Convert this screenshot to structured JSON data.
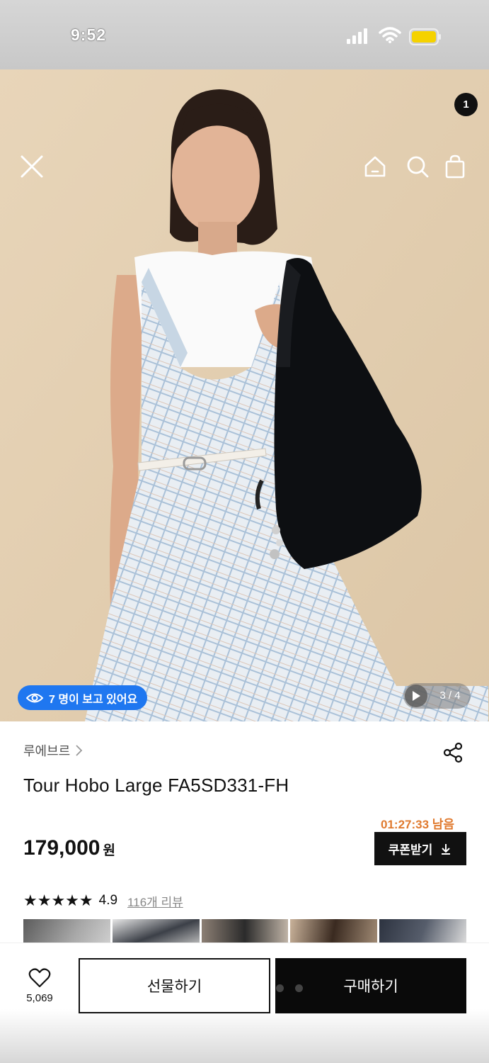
{
  "status": {
    "time": "9:52"
  },
  "hero": {
    "viewers": "7 명이 보고 있어요",
    "page": "3 / 4",
    "cart_count": "1"
  },
  "product": {
    "brand": "루에브르",
    "title": "Tour Hobo Large FA5SD331-FH",
    "timer": "01:27:33 남음",
    "price": "179,000",
    "currency": "원",
    "coupon_label": "쿠폰받기",
    "stars": "★★★★★",
    "rating": "4.9",
    "reviews": "116개 리뷰"
  },
  "bottom": {
    "wish_count": "5,069",
    "gift_label": "선물하기",
    "buy_label": "구매하기"
  },
  "colors": {
    "accent": "#1f77f0",
    "timer": "#e07a2e",
    "dark": "#111111"
  },
  "icons": [
    "close-icon",
    "home-icon",
    "search-icon",
    "cart-icon",
    "eye-icon",
    "play-icon",
    "chevron-right-icon",
    "share-icon",
    "download-icon",
    "heart-icon"
  ]
}
